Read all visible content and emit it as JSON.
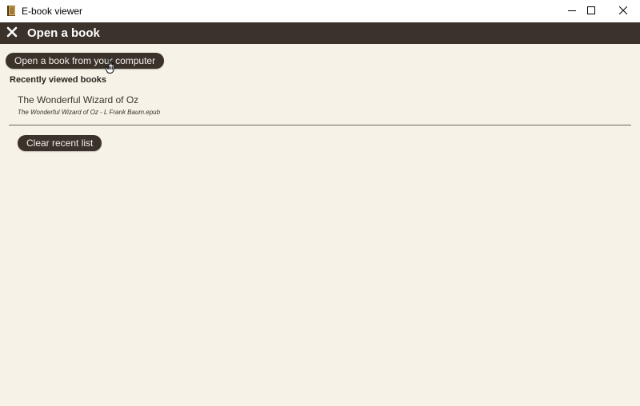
{
  "window": {
    "title": "E-book viewer"
  },
  "header": {
    "title": "Open a book"
  },
  "actions": {
    "open_label": "Open a book from your computer",
    "clear_label": "Clear recent list"
  },
  "recent": {
    "heading": "Recently viewed books",
    "items": [
      {
        "title": "The Wonderful Wizard of Oz",
        "file": "The Wonderful Wizard of Oz - L Frank Baum.epub"
      }
    ]
  },
  "icons": {
    "app": "ebook-viewer-icon",
    "header_close": "close-icon",
    "minimize": "minimize-icon",
    "maximize": "maximize-icon",
    "close": "close-icon",
    "cursor": "hand-pointer-icon"
  },
  "colors": {
    "header_bg": "#3b322b",
    "content_bg": "#f6f2e8",
    "button_bg": "#3b322b",
    "button_text": "#f3efe6"
  }
}
